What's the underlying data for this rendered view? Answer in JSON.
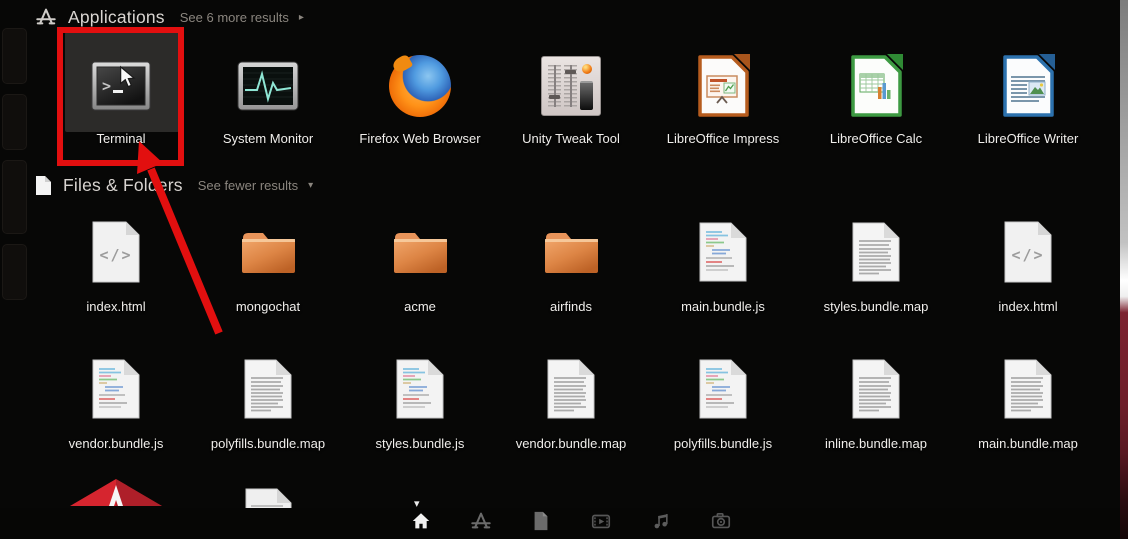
{
  "dash": {
    "applications": {
      "title": "Applications",
      "toggle": "See 6 more results",
      "toggle_arrow": "▸",
      "items": [
        {
          "label": "Terminal",
          "icon": "terminal"
        },
        {
          "label": "System Monitor",
          "icon": "system-monitor"
        },
        {
          "label": "Firefox Web Browser",
          "icon": "firefox"
        },
        {
          "label": "Unity Tweak Tool",
          "icon": "unity-tweak-tool"
        },
        {
          "label": "LibreOffice Impress",
          "icon": "libreoffice-impress"
        },
        {
          "label": "LibreOffice Calc",
          "icon": "libreoffice-calc"
        },
        {
          "label": "LibreOffice Writer",
          "icon": "libreoffice-writer"
        }
      ]
    },
    "files": {
      "title": "Files & Folders",
      "toggle": "See fewer results",
      "toggle_arrow": "▾",
      "row1": [
        {
          "label": "index.html",
          "icon": "code-file"
        },
        {
          "label": "mongochat",
          "icon": "folder"
        },
        {
          "label": "acme",
          "icon": "folder"
        },
        {
          "label": "airfinds",
          "icon": "folder"
        },
        {
          "label": "main.bundle.js",
          "icon": "source-file"
        },
        {
          "label": "styles.bundle.map",
          "icon": "text-file"
        },
        {
          "label": "index.html",
          "icon": "code-file"
        }
      ],
      "row2": [
        {
          "label": "vendor.bundle.js",
          "icon": "source-file"
        },
        {
          "label": "polyfills.bundle.map",
          "icon": "text-file"
        },
        {
          "label": "styles.bundle.js",
          "icon": "source-file"
        },
        {
          "label": "vendor.bundle.map",
          "icon": "text-file"
        },
        {
          "label": "polyfills.bundle.js",
          "icon": "source-file"
        },
        {
          "label": "inline.bundle.map",
          "icon": "text-file"
        },
        {
          "label": "main.bundle.map",
          "icon": "text-file"
        }
      ]
    },
    "lens_bar": {
      "active": "home",
      "lenses": [
        "home",
        "applications",
        "files",
        "video",
        "music",
        "photos"
      ]
    },
    "annotation": {
      "type": "red box and arrow",
      "color": "#e20f0f",
      "target": "Terminal"
    },
    "colors": {
      "background": "#070706",
      "label": "#f0eeeb",
      "muted": "#8a857e",
      "folder": "#d98b4e"
    }
  }
}
